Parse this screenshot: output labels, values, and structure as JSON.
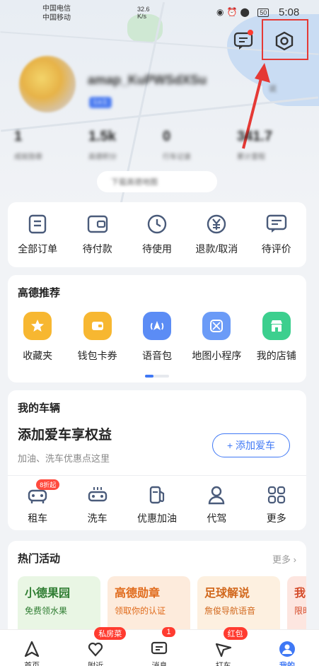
{
  "status_bar": {
    "carrier1": "中国电信",
    "carrier2": "中国移动",
    "speed_value": "32.6",
    "speed_unit": "K/s",
    "battery": "50",
    "time": "5:08"
  },
  "profile": {
    "username": "amap_KuPWSdXSu",
    "level": "Lv.1",
    "extra": "说"
  },
  "stats": [
    {
      "num": "1",
      "label": "成就勋章"
    },
    {
      "num": "1.5k",
      "label": "高德积分"
    },
    {
      "num": "0",
      "label": "行车记录"
    },
    {
      "num": "341.7",
      "label": "累计里程"
    }
  ],
  "pill_text": "下载高德地图",
  "orders": [
    {
      "label": "全部订单",
      "icon": "list-icon"
    },
    {
      "label": "待付款",
      "icon": "wallet-icon"
    },
    {
      "label": "待使用",
      "icon": "clock-icon"
    },
    {
      "label": "退款/取消",
      "icon": "yuan-icon"
    },
    {
      "label": "待评价",
      "icon": "comment-icon"
    }
  ],
  "recommend": {
    "title": "高德推荐",
    "items": [
      {
        "label": "收藏夹",
        "icon": "star-icon",
        "color": "#f7b731"
      },
      {
        "label": "钱包卡券",
        "icon": "wallet-card-icon",
        "color": "#f7b731"
      },
      {
        "label": "语音包",
        "icon": "voice-icon",
        "color": "#5b8cf5"
      },
      {
        "label": "地图小程序",
        "icon": "map-icon",
        "color": "#6b9bf7"
      },
      {
        "label": "我的店铺",
        "icon": "shop-icon",
        "color": "#3ccf8e"
      }
    ]
  },
  "vehicle": {
    "title": "我的车辆",
    "promo_title": "添加爱车享权益",
    "promo_sub": "加油、洗车优惠点这里",
    "add_button": "+ 添加爱车",
    "items": [
      {
        "label": "租车",
        "icon": "rent-car-icon",
        "badge": "8折起"
      },
      {
        "label": "洗车",
        "icon": "car-wash-icon"
      },
      {
        "label": "优惠加油",
        "icon": "fuel-icon"
      },
      {
        "label": "代驾",
        "icon": "driver-icon"
      },
      {
        "label": "更多",
        "icon": "grid-icon"
      }
    ]
  },
  "events": {
    "title": "热门活动",
    "more": "更多",
    "cards": [
      {
        "title": "小德果园",
        "sub": "免费领水果",
        "bg": "#e9f6e4",
        "color": "#2f7d32"
      },
      {
        "title": "高德勋章",
        "sub": "领取你的认证",
        "bg": "#fdebdc",
        "color": "#e06a1a"
      },
      {
        "title": "足球解说",
        "sub": "詹俊导航语音",
        "bg": "#fdf0e0",
        "color": "#d2691e"
      },
      {
        "title": "我",
        "sub": "限时",
        "bg": "#fde6e0",
        "color": "#d44b2a"
      }
    ]
  },
  "tabbar": [
    {
      "label": "首页",
      "icon": "navigate-icon"
    },
    {
      "label": "附近",
      "icon": "nearby-icon",
      "badge": "私房菜"
    },
    {
      "label": "消息",
      "icon": "message-icon",
      "badge": "1"
    },
    {
      "label": "打车",
      "icon": "taxi-icon",
      "badge": "红包"
    },
    {
      "label": "我的",
      "icon": "profile-icon"
    }
  ]
}
